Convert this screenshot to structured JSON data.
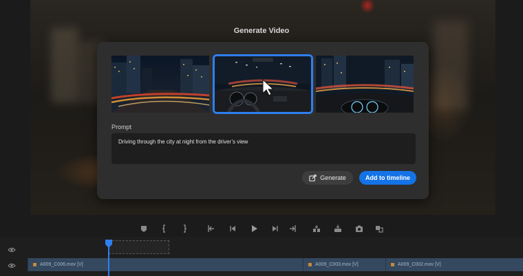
{
  "dialog": {
    "title": "Generate Video",
    "prompt_label": "Prompt",
    "prompt_value": "Driving through the city at night from the driver’s view",
    "selected_thumbnail": 2,
    "generate_label": "Generate",
    "add_label": "Add to timeline"
  },
  "timeline": {
    "clips": [
      {
        "label": "A009_C006.mov [V]"
      },
      {
        "label": "A009_C003.mov [V]"
      },
      {
        "label": "A009_C002.mov [V]"
      }
    ]
  },
  "colors": {
    "accent": "#1473e6",
    "selection_border": "#2f7ff0",
    "dialog_bg": "#2e2e2e",
    "clip_track": "#34485f"
  },
  "icons": {
    "transport": [
      "add-marker-icon",
      "mark-in-icon",
      "mark-out-icon",
      "go-to-in-icon",
      "step-back-icon",
      "play-icon",
      "step-forward-icon",
      "go-to-out-icon",
      "insert-icon",
      "overwrite-icon",
      "export-frame-icon",
      "comparison-view-icon"
    ],
    "generate": "generate-edit-icon",
    "track_visibility": "eye-icon"
  }
}
